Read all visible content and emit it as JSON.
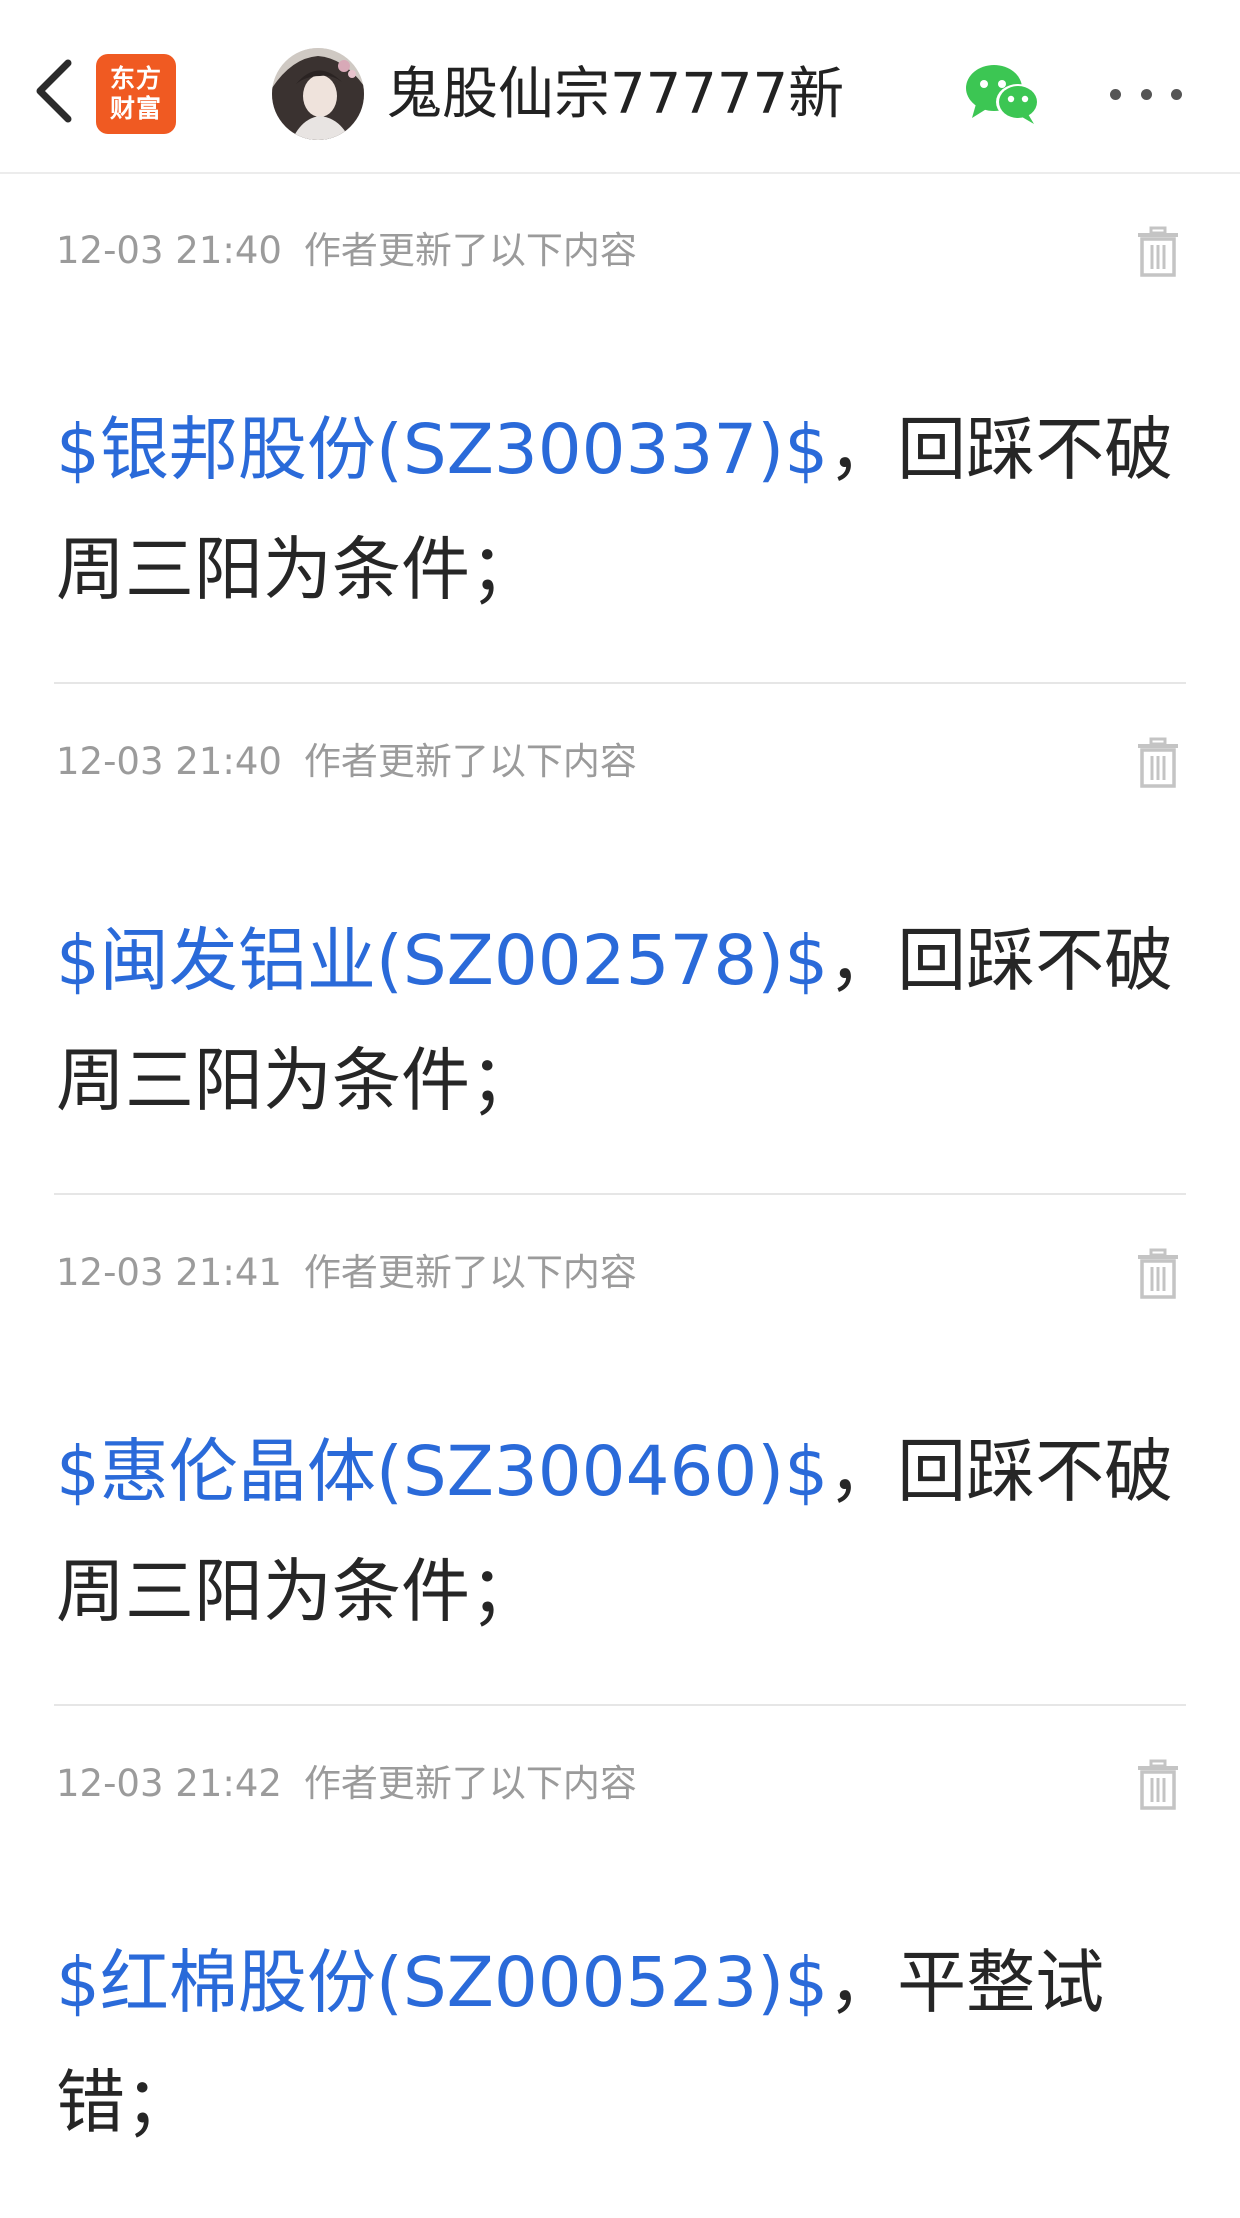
{
  "header": {
    "logo_line1": "东方",
    "logo_line2": "财富",
    "author_name": "鬼股仙宗77777新"
  },
  "colors": {
    "link": "#2a6ad9",
    "logo": "#f05a22",
    "wechat": "#3cc653",
    "meta": "#9b9b9b"
  },
  "icons": [
    "back-arrow-icon",
    "eastmoney-logo",
    "avatar",
    "wechat-icon",
    "more-icon",
    "trash-icon"
  ],
  "posts": [
    {
      "time": "12-03 21:40",
      "action": "作者更新了以下内容",
      "stock": "$银邦股份(SZ300337)$",
      "text": "，回踩不破周三阳为条件；"
    },
    {
      "time": "12-03 21:40",
      "action": "作者更新了以下内容",
      "stock": "$闽发铝业(SZ002578)$",
      "text": "，回踩不破周三阳为条件；"
    },
    {
      "time": "12-03 21:41",
      "action": "作者更新了以下内容",
      "stock": "$惠伦晶体(SZ300460)$",
      "text": "，回踩不破周三阳为条件；"
    },
    {
      "time": "12-03 21:42",
      "action": "作者更新了以下内容",
      "stock": "$红棉股份(SZ000523)$",
      "text": "，平整试错；"
    }
  ]
}
